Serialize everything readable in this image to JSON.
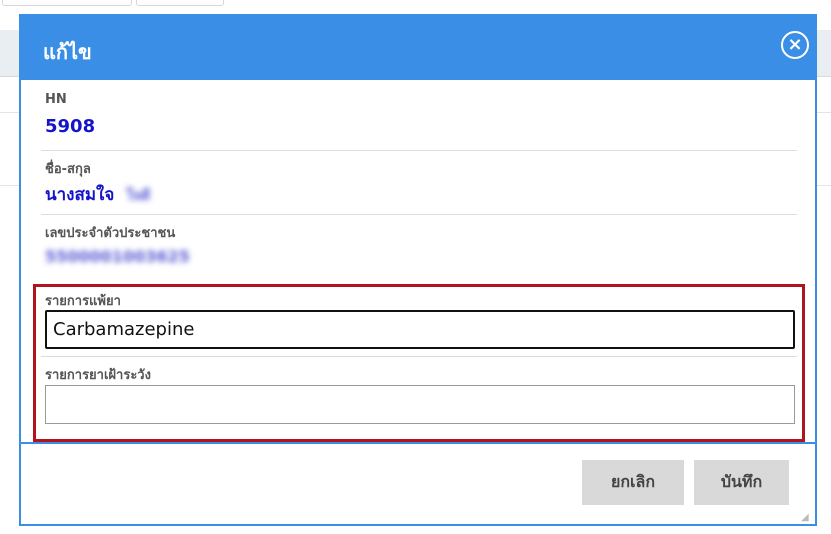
{
  "modal": {
    "title": "แก้ไข",
    "close_icon": "close-circle-icon"
  },
  "fields": {
    "hn_label": "HN",
    "hn_value": "5908",
    "name_label": "ชื่อ-สกุล",
    "name_value": "นางสมใจ",
    "name_redacted": "ใจดี",
    "id_label": "เลขประจำตัวประชาชน",
    "id_redacted": "5500001003625"
  },
  "allergy": {
    "label": "รายการแพ้ยา",
    "value": "Carbamazepine"
  },
  "watch": {
    "label": "รายการยาเฝ้าระวัง",
    "value": ""
  },
  "footer": {
    "cancel_label": "ยกเลิก",
    "save_label": "บันทึก"
  },
  "colors": {
    "header": "#3a8ee6",
    "value_text": "#1414c8",
    "highlight_border": "#b0141c"
  }
}
